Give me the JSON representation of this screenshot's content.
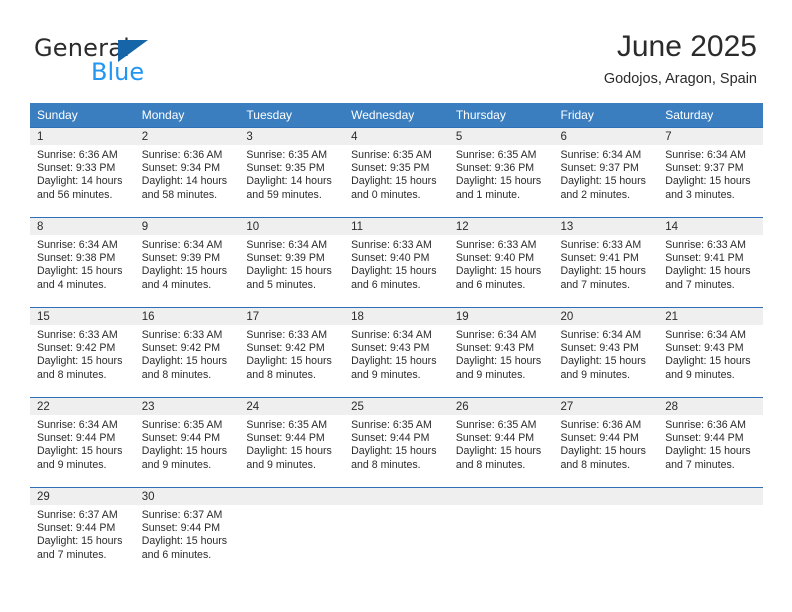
{
  "brand": {
    "name_top": "General",
    "name_bottom": "Blue",
    "triangle_color": "#1565a8",
    "blue_color": "#2196f3"
  },
  "header": {
    "title": "June 2025",
    "location": "Godojos, Aragon, Spain"
  },
  "theme": {
    "header_bg": "#3a7ec0",
    "row_border": "#2f6fb5",
    "daynum_bg": "#efefef",
    "text": "#2b2b2b"
  },
  "weekdays": [
    "Sunday",
    "Monday",
    "Tuesday",
    "Wednesday",
    "Thursday",
    "Friday",
    "Saturday"
  ],
  "labels": {
    "sunrise_prefix": "Sunrise: ",
    "sunset_prefix": "Sunset: ",
    "daylight_prefix": "Daylight: "
  },
  "weeks": [
    [
      {
        "day": "1",
        "sunrise": "Sunrise: 6:36 AM",
        "sunset": "Sunset: 9:33 PM",
        "daylight": "Daylight: 14 hours and 56 minutes."
      },
      {
        "day": "2",
        "sunrise": "Sunrise: 6:36 AM",
        "sunset": "Sunset: 9:34 PM",
        "daylight": "Daylight: 14 hours and 58 minutes."
      },
      {
        "day": "3",
        "sunrise": "Sunrise: 6:35 AM",
        "sunset": "Sunset: 9:35 PM",
        "daylight": "Daylight: 14 hours and 59 minutes."
      },
      {
        "day": "4",
        "sunrise": "Sunrise: 6:35 AM",
        "sunset": "Sunset: 9:35 PM",
        "daylight": "Daylight: 15 hours and 0 minutes."
      },
      {
        "day": "5",
        "sunrise": "Sunrise: 6:35 AM",
        "sunset": "Sunset: 9:36 PM",
        "daylight": "Daylight: 15 hours and 1 minute."
      },
      {
        "day": "6",
        "sunrise": "Sunrise: 6:34 AM",
        "sunset": "Sunset: 9:37 PM",
        "daylight": "Daylight: 15 hours and 2 minutes."
      },
      {
        "day": "7",
        "sunrise": "Sunrise: 6:34 AM",
        "sunset": "Sunset: 9:37 PM",
        "daylight": "Daylight: 15 hours and 3 minutes."
      }
    ],
    [
      {
        "day": "8",
        "sunrise": "Sunrise: 6:34 AM",
        "sunset": "Sunset: 9:38 PM",
        "daylight": "Daylight: 15 hours and 4 minutes."
      },
      {
        "day": "9",
        "sunrise": "Sunrise: 6:34 AM",
        "sunset": "Sunset: 9:39 PM",
        "daylight": "Daylight: 15 hours and 4 minutes."
      },
      {
        "day": "10",
        "sunrise": "Sunrise: 6:34 AM",
        "sunset": "Sunset: 9:39 PM",
        "daylight": "Daylight: 15 hours and 5 minutes."
      },
      {
        "day": "11",
        "sunrise": "Sunrise: 6:33 AM",
        "sunset": "Sunset: 9:40 PM",
        "daylight": "Daylight: 15 hours and 6 minutes."
      },
      {
        "day": "12",
        "sunrise": "Sunrise: 6:33 AM",
        "sunset": "Sunset: 9:40 PM",
        "daylight": "Daylight: 15 hours and 6 minutes."
      },
      {
        "day": "13",
        "sunrise": "Sunrise: 6:33 AM",
        "sunset": "Sunset: 9:41 PM",
        "daylight": "Daylight: 15 hours and 7 minutes."
      },
      {
        "day": "14",
        "sunrise": "Sunrise: 6:33 AM",
        "sunset": "Sunset: 9:41 PM",
        "daylight": "Daylight: 15 hours and 7 minutes."
      }
    ],
    [
      {
        "day": "15",
        "sunrise": "Sunrise: 6:33 AM",
        "sunset": "Sunset: 9:42 PM",
        "daylight": "Daylight: 15 hours and 8 minutes."
      },
      {
        "day": "16",
        "sunrise": "Sunrise: 6:33 AM",
        "sunset": "Sunset: 9:42 PM",
        "daylight": "Daylight: 15 hours and 8 minutes."
      },
      {
        "day": "17",
        "sunrise": "Sunrise: 6:33 AM",
        "sunset": "Sunset: 9:42 PM",
        "daylight": "Daylight: 15 hours and 8 minutes."
      },
      {
        "day": "18",
        "sunrise": "Sunrise: 6:34 AM",
        "sunset": "Sunset: 9:43 PM",
        "daylight": "Daylight: 15 hours and 9 minutes."
      },
      {
        "day": "19",
        "sunrise": "Sunrise: 6:34 AM",
        "sunset": "Sunset: 9:43 PM",
        "daylight": "Daylight: 15 hours and 9 minutes."
      },
      {
        "day": "20",
        "sunrise": "Sunrise: 6:34 AM",
        "sunset": "Sunset: 9:43 PM",
        "daylight": "Daylight: 15 hours and 9 minutes."
      },
      {
        "day": "21",
        "sunrise": "Sunrise: 6:34 AM",
        "sunset": "Sunset: 9:43 PM",
        "daylight": "Daylight: 15 hours and 9 minutes."
      }
    ],
    [
      {
        "day": "22",
        "sunrise": "Sunrise: 6:34 AM",
        "sunset": "Sunset: 9:44 PM",
        "daylight": "Daylight: 15 hours and 9 minutes."
      },
      {
        "day": "23",
        "sunrise": "Sunrise: 6:35 AM",
        "sunset": "Sunset: 9:44 PM",
        "daylight": "Daylight: 15 hours and 9 minutes."
      },
      {
        "day": "24",
        "sunrise": "Sunrise: 6:35 AM",
        "sunset": "Sunset: 9:44 PM",
        "daylight": "Daylight: 15 hours and 9 minutes."
      },
      {
        "day": "25",
        "sunrise": "Sunrise: 6:35 AM",
        "sunset": "Sunset: 9:44 PM",
        "daylight": "Daylight: 15 hours and 8 minutes."
      },
      {
        "day": "26",
        "sunrise": "Sunrise: 6:35 AM",
        "sunset": "Sunset: 9:44 PM",
        "daylight": "Daylight: 15 hours and 8 minutes."
      },
      {
        "day": "27",
        "sunrise": "Sunrise: 6:36 AM",
        "sunset": "Sunset: 9:44 PM",
        "daylight": "Daylight: 15 hours and 8 minutes."
      },
      {
        "day": "28",
        "sunrise": "Sunrise: 6:36 AM",
        "sunset": "Sunset: 9:44 PM",
        "daylight": "Daylight: 15 hours and 7 minutes."
      }
    ],
    [
      {
        "day": "29",
        "sunrise": "Sunrise: 6:37 AM",
        "sunset": "Sunset: 9:44 PM",
        "daylight": "Daylight: 15 hours and 7 minutes."
      },
      {
        "day": "30",
        "sunrise": "Sunrise: 6:37 AM",
        "sunset": "Sunset: 9:44 PM",
        "daylight": "Daylight: 15 hours and 6 minutes."
      },
      {
        "day": "",
        "sunrise": "",
        "sunset": "",
        "daylight": ""
      },
      {
        "day": "",
        "sunrise": "",
        "sunset": "",
        "daylight": ""
      },
      {
        "day": "",
        "sunrise": "",
        "sunset": "",
        "daylight": ""
      },
      {
        "day": "",
        "sunrise": "",
        "sunset": "",
        "daylight": ""
      },
      {
        "day": "",
        "sunrise": "",
        "sunset": "",
        "daylight": ""
      }
    ]
  ]
}
